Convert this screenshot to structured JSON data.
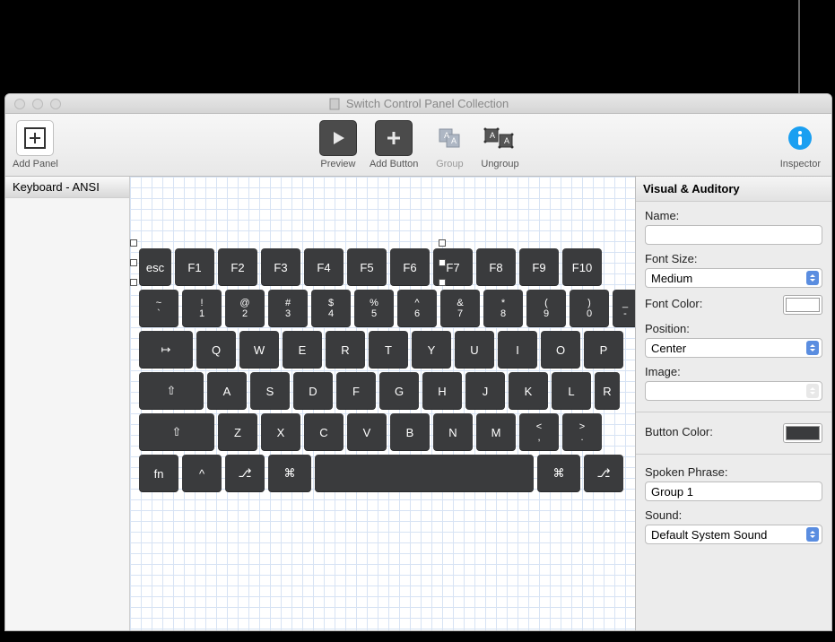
{
  "window": {
    "title": "Switch Control Panel Collection"
  },
  "toolbar": {
    "add_panel": "Add Panel",
    "preview": "Preview",
    "add_button": "Add Button",
    "group": "Group",
    "ungroup": "Ungroup",
    "inspector": "Inspector"
  },
  "sidebar": {
    "items": [
      "Keyboard - ANSI"
    ]
  },
  "keyboard": {
    "row0": [
      "esc",
      "F1",
      "F2",
      "F3",
      "F4",
      "F5",
      "F6",
      "F7",
      "F8",
      "F9",
      "F10"
    ],
    "row1": [
      [
        "~",
        "`"
      ],
      [
        "!",
        "1"
      ],
      [
        "@",
        "2"
      ],
      [
        "#",
        "3"
      ],
      [
        "$",
        "4"
      ],
      [
        "%",
        "5"
      ],
      [
        "^",
        "6"
      ],
      [
        "&",
        "7"
      ],
      [
        "*",
        "8"
      ],
      [
        "(",
        "9"
      ],
      [
        ")",
        "0"
      ],
      [
        "_",
        "-"
      ]
    ],
    "row2": [
      "↦",
      "Q",
      "W",
      "E",
      "R",
      "T",
      "Y",
      "U",
      "I",
      "O",
      "P"
    ],
    "row3": [
      "⇧",
      "A",
      "S",
      "D",
      "F",
      "G",
      "H",
      "J",
      "K",
      "L",
      "R"
    ],
    "row4": [
      "⇧",
      "Z",
      "X",
      "C",
      "V",
      "B",
      "N",
      "M",
      [
        "<",
        ","
      ],
      [
        ">",
        "."
      ]
    ],
    "row5": [
      "fn",
      "^",
      "⎇",
      "⌘",
      "",
      "⌘",
      "⎇"
    ]
  },
  "inspector": {
    "header": "Visual & Auditory",
    "labels": {
      "name": "Name:",
      "font_size": "Font Size:",
      "font_color": "Font Color:",
      "position": "Position:",
      "image": "Image:",
      "button_color": "Button Color:",
      "spoken_phrase": "Spoken Phrase:",
      "sound": "Sound:"
    },
    "values": {
      "name": "",
      "font_size": "Medium",
      "font_color": "#ffffff",
      "position": "Center",
      "image": "",
      "button_color": "#3a3b3d",
      "spoken_phrase": "Group 1",
      "sound": "Default System Sound"
    }
  }
}
